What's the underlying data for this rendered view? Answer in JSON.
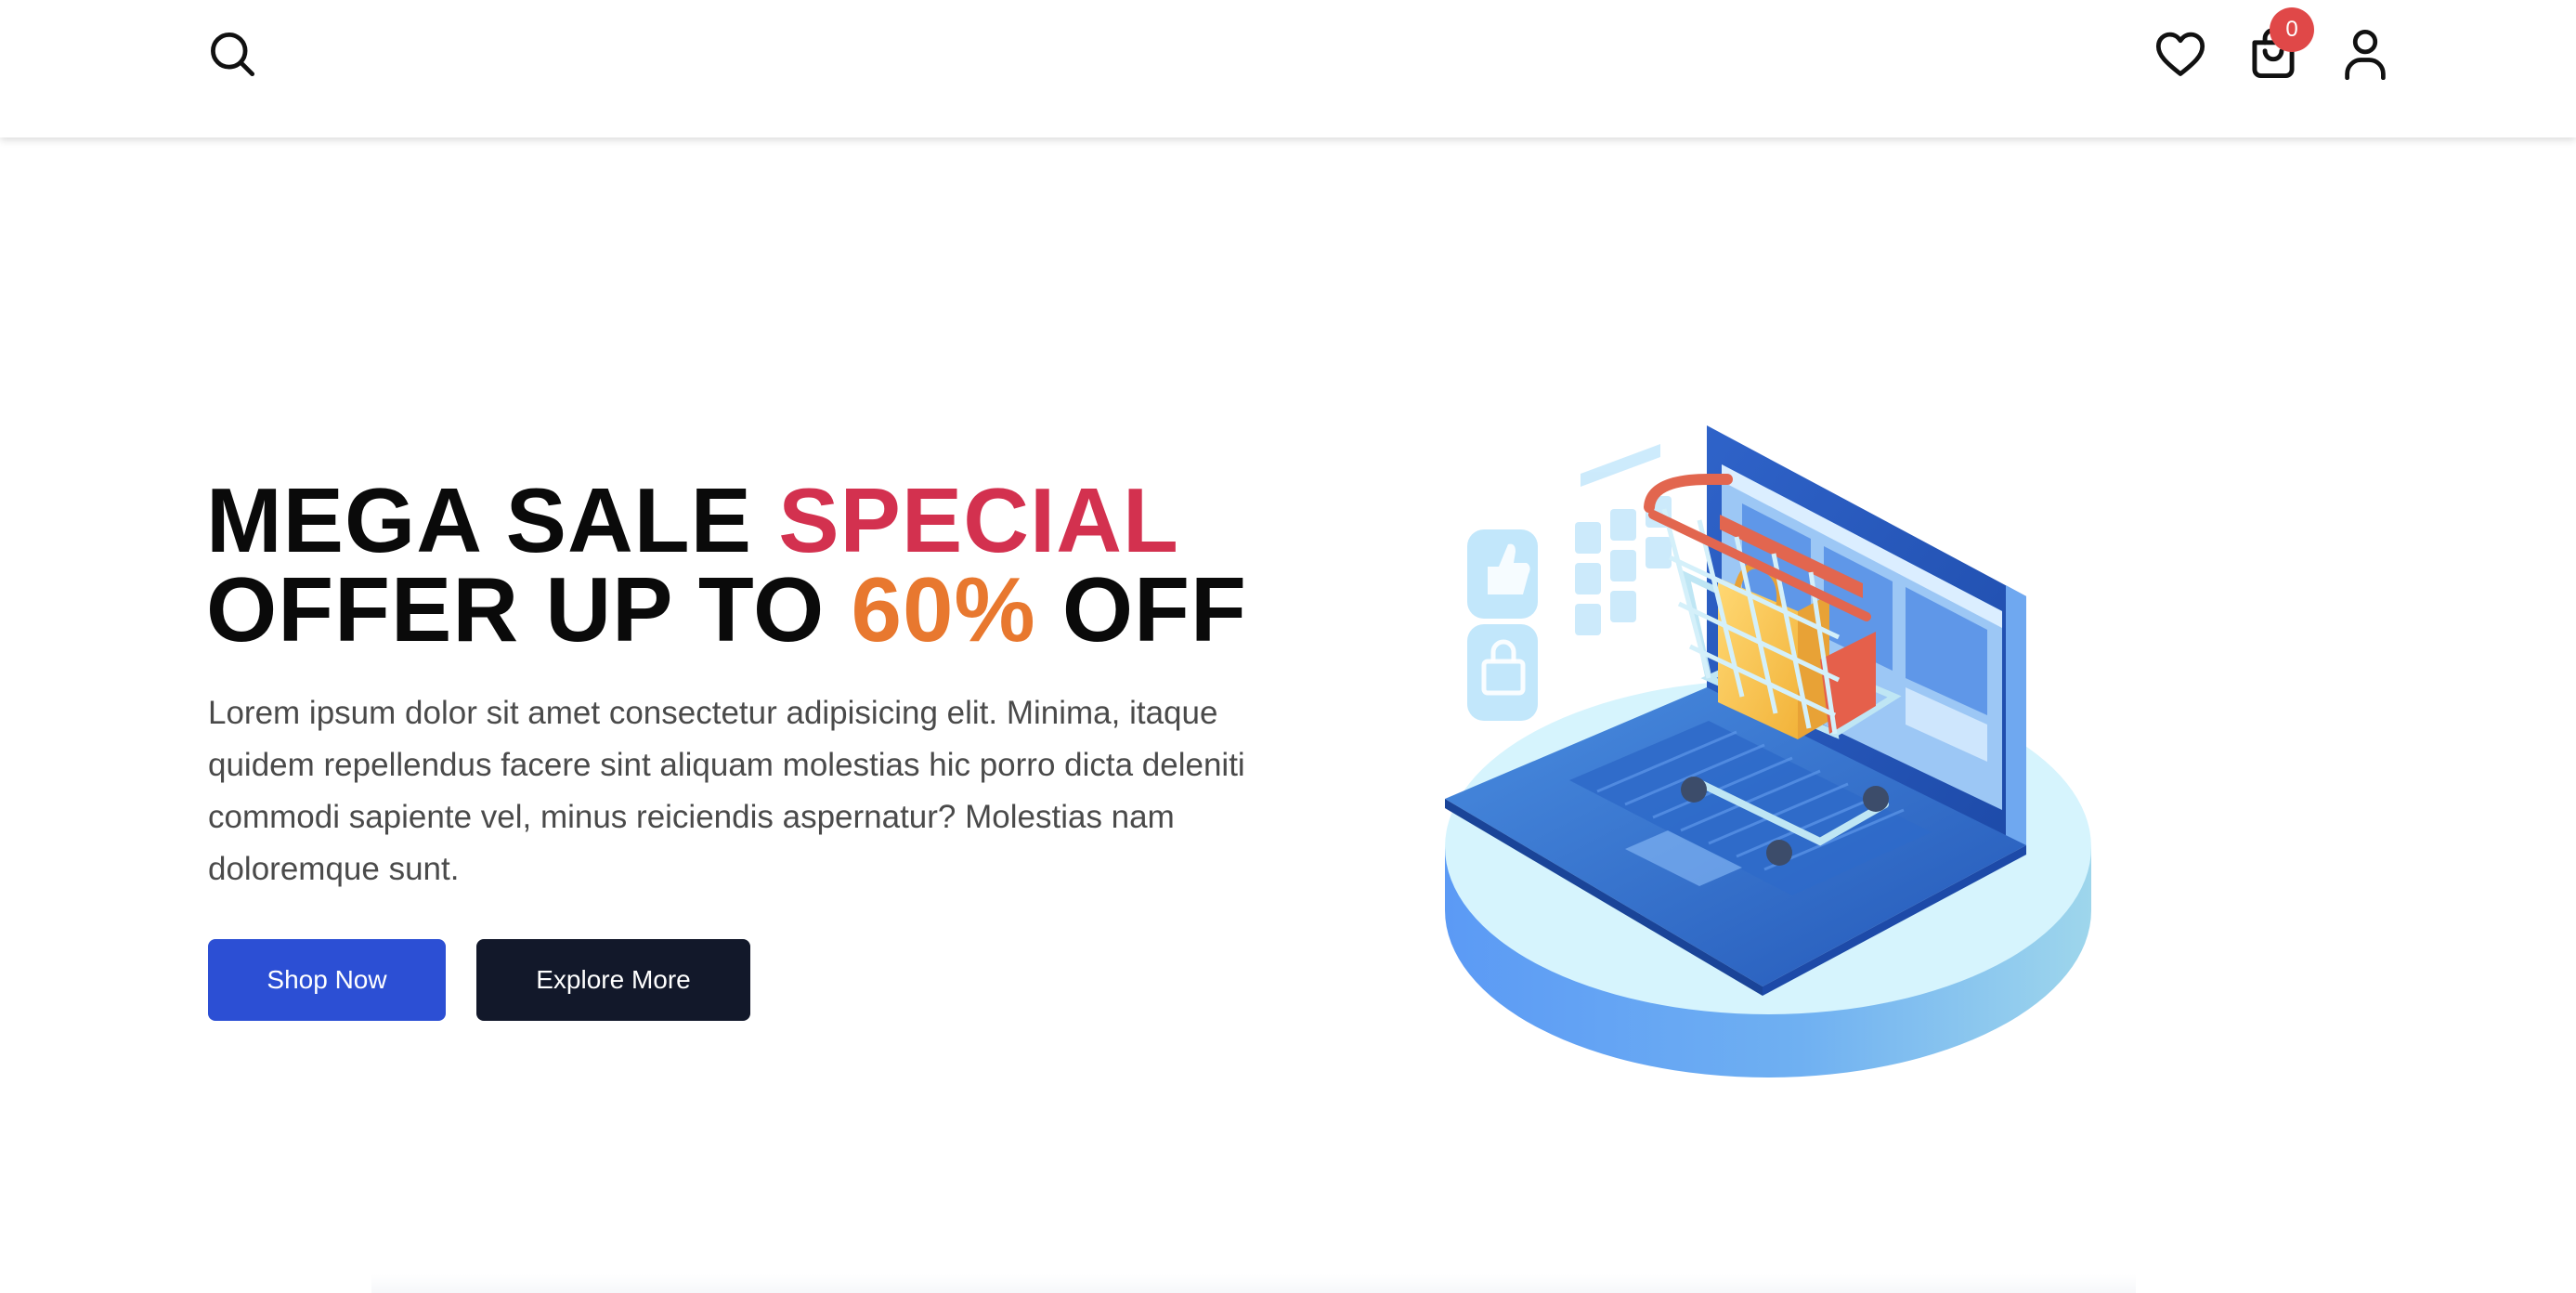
{
  "header": {
    "icons": {
      "search": "search-icon",
      "wishlist": "heart-icon",
      "cart": "shopping-bag-icon",
      "account": "user-icon"
    },
    "cart_count": "0"
  },
  "hero": {
    "title_part1": "MEGA SALE ",
    "title_highlight1": "SPECIAL",
    "title_part2": "OFFER UP TO ",
    "title_highlight2": "60%",
    "title_part3": " OFF",
    "description": "Lorem ipsum dolor sit amet consectetur adipisicing elit. Minima, itaque quidem repellendus facere sint aliquam molestias hic porro dicta deleniti commodi sapiente vel, minus reiciendis aspernatur? Molestias nam doloremque sunt.",
    "primary_button": "Shop Now",
    "secondary_button": "Explore More",
    "illustration": "laptop-shopping-cart-illustration"
  },
  "colors": {
    "accent_red": "#d3314f",
    "accent_orange": "#e8782f",
    "primary_button": "#2c4fd4",
    "secondary_button": "#12182a",
    "badge": "#e04848"
  }
}
